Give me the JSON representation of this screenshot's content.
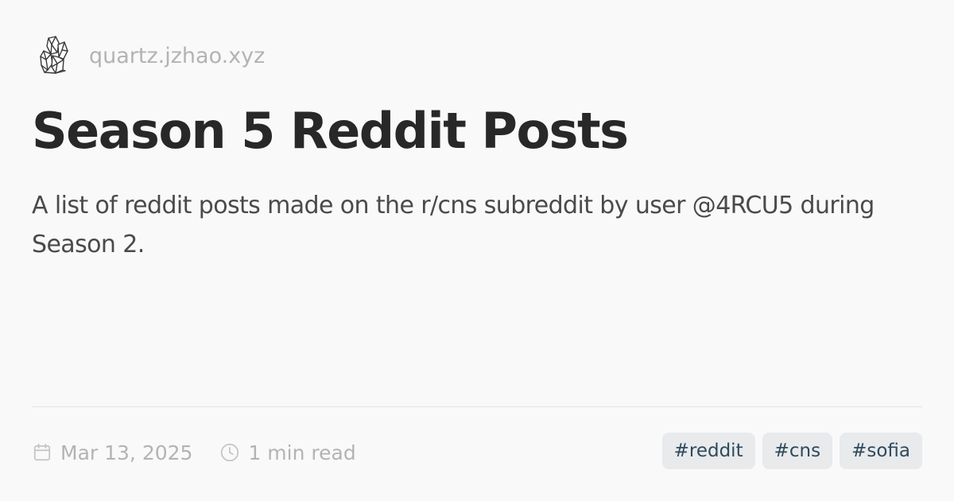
{
  "header": {
    "logo_icon": "crystal-logo-icon",
    "site_name": "quartz.jzhao.xyz"
  },
  "page": {
    "title": "Season 5 Reddit Posts",
    "description": "A list of reddit posts made on the r/cns subreddit by user @4RCU5 during Season 2."
  },
  "meta": {
    "date_icon": "calendar-icon",
    "date": "Mar 13, 2025",
    "read_time_icon": "clock-icon",
    "read_time": "1 min read"
  },
  "tags": [
    {
      "label": "#reddit"
    },
    {
      "label": "#cns"
    },
    {
      "label": "#sofia"
    }
  ],
  "colors": {
    "background": "#faf9fa",
    "title": "#282828",
    "description": "#4a4a4a",
    "muted": "#b3b3b3",
    "tag_background": "#e8eaec",
    "tag_text": "#2e4a5c"
  }
}
